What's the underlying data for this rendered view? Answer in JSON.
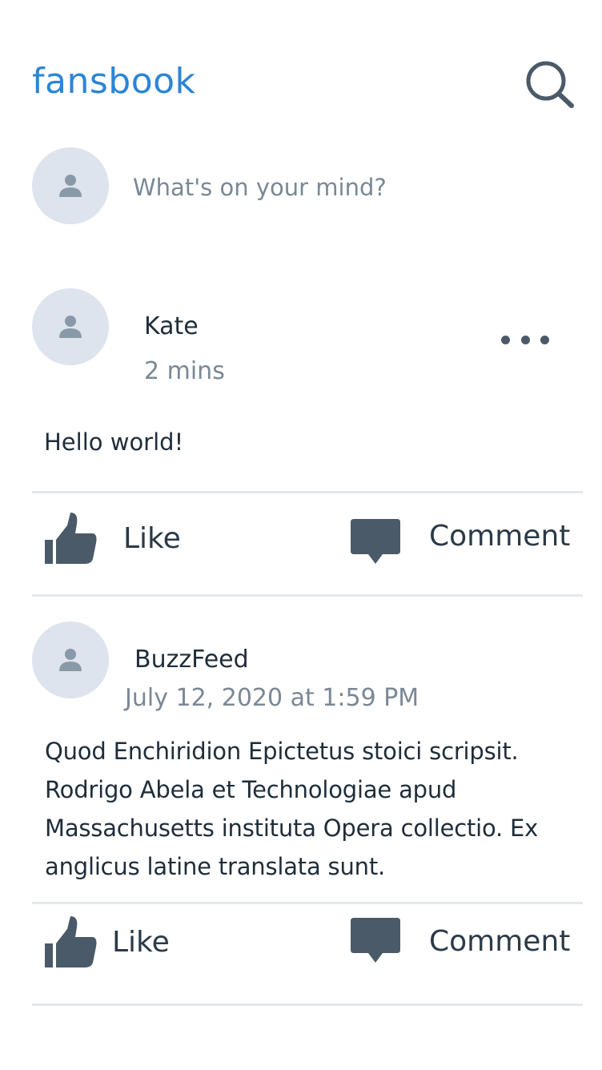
{
  "app": {
    "title": "fansbook"
  },
  "header": {
    "search_icon": "search-icon"
  },
  "composer": {
    "placeholder": "What's on your mind?"
  },
  "posts": [
    {
      "author": "Kate",
      "time": "2 mins",
      "body": "Hello world!",
      "like_label": "Like",
      "comment_label": "Comment"
    },
    {
      "author": "BuzzFeed",
      "time": "July 12, 2020 at 1:59 PM",
      "body": "Quod Enchiridion Epictetus stoici scripsit. Rodrigo Abela et Technologiae apud Massachusetts instituta Opera collectio. Ex anglicus latine translata sunt.",
      "like_label": "Like",
      "comment_label": "Comment"
    }
  ],
  "colors": {
    "brand": "#2b85d6",
    "icon": "#4a5a68",
    "avatar_bg": "#dde4ed",
    "muted_text": "#7a8896",
    "divider": "#e3e8ee"
  }
}
